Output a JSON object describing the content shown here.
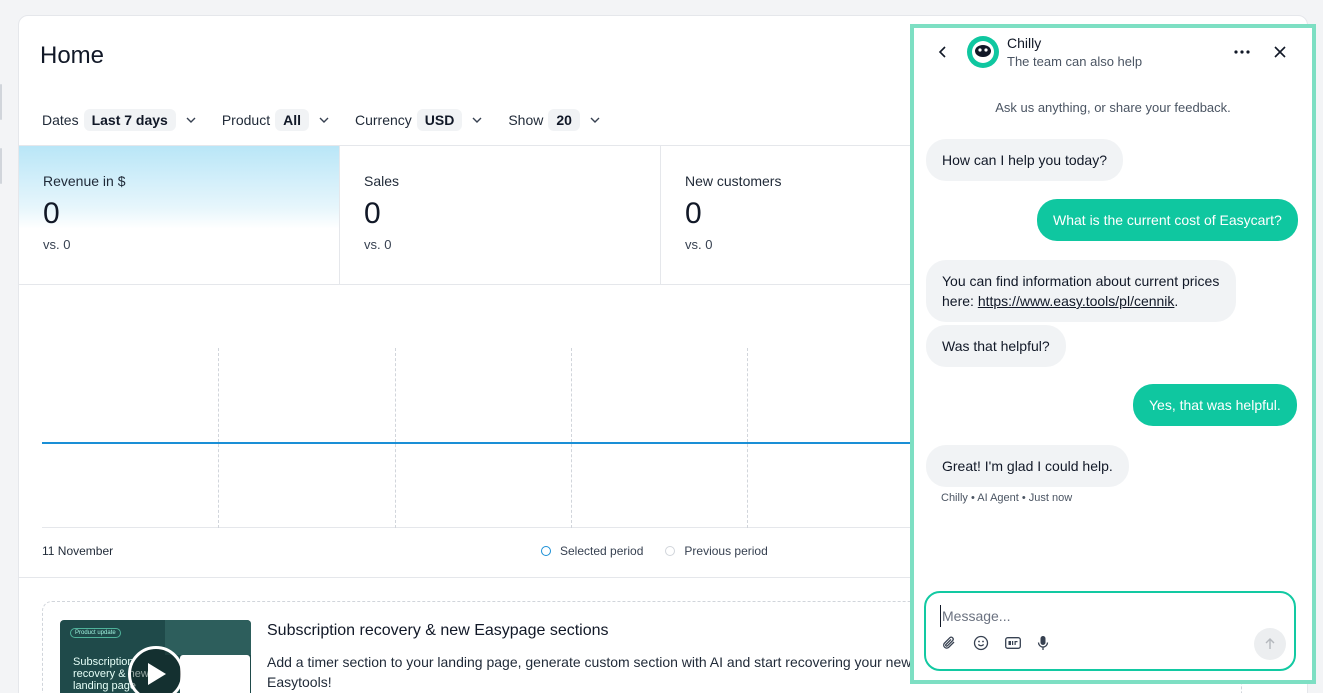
{
  "page": {
    "title": "Home"
  },
  "filters": [
    {
      "label": "Dates",
      "value": "Last 7 days"
    },
    {
      "label": "Product",
      "value": "All"
    },
    {
      "label": "Currency",
      "value": "USD"
    },
    {
      "label": "Show",
      "value": "20"
    }
  ],
  "stats": [
    {
      "label": "Revenue in $",
      "value": "0",
      "compare": "vs. 0"
    },
    {
      "label": "Sales",
      "value": "0",
      "compare": "vs. 0"
    },
    {
      "label": "New customers",
      "value": "0",
      "compare": "vs. 0"
    }
  ],
  "chart": {
    "x_label": "11 November",
    "legend": [
      {
        "label": "Selected period",
        "color": "#1a8fd6"
      },
      {
        "label": "Previous period",
        "color": "#d1d5db"
      }
    ]
  },
  "chart_data": {
    "type": "line",
    "title": "",
    "xlabel": "",
    "ylabel": "",
    "categories": [
      "11 November"
    ],
    "series": [
      {
        "name": "Selected period",
        "values": [
          0
        ]
      },
      {
        "name": "Previous period",
        "values": [
          0
        ]
      }
    ],
    "grid": true,
    "legend_position": "bottom"
  },
  "news": {
    "thumb_pill": "Product update",
    "thumb_text": "Subscription recovery & new landing page",
    "title": "Subscription recovery & new Easypage sections",
    "body": "Add a timer section to your landing page, generate custom section with AI and start recovering your new in Easytools!"
  },
  "chat": {
    "name": "Chilly",
    "subtitle": "The team can also help",
    "intro": "Ask us anything, or share your feedback.",
    "messages": {
      "m1": "How can I help you today?",
      "m2": "What is the current cost of Easycart?",
      "m3_text": "You can find information about current prices here: ",
      "m3_link": "https://www.easy.tools/pl/cennik",
      "m3_end": ".",
      "m4": "Was that helpful?",
      "m5": "Yes, that was helpful.",
      "m6": "Great! I'm glad I could help."
    },
    "meta": "Chilly • AI Agent • Just now",
    "composer_placeholder": "Message...",
    "accent": "#0fc7a0"
  }
}
